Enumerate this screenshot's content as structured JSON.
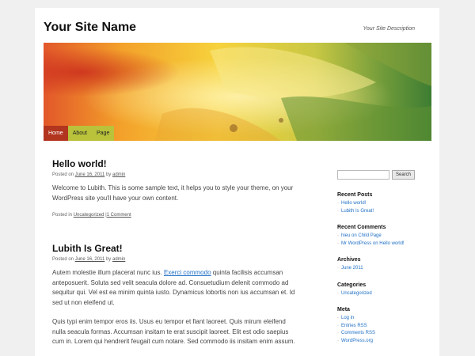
{
  "site": {
    "title": "Your Site Name",
    "description": "Your Site Description"
  },
  "nav": {
    "items": [
      {
        "label": "Home",
        "active": true
      },
      {
        "label": "About",
        "active": false
      },
      {
        "label": "Page",
        "active": false
      }
    ]
  },
  "posts": [
    {
      "title": "Hello world!",
      "meta_prefix": "Posted on",
      "date": "June 16, 2011",
      "by": "by",
      "author": "admin",
      "body": [
        "Welcome to Lubith. This is some sample text, it helps you to style your theme, on your WordPress site you'll have your own content."
      ],
      "footer_prefix": "Posted in",
      "category": "Uncategorized",
      "separator": "|",
      "comments": "1 Comment"
    },
    {
      "title": "Lubith Is Great!",
      "meta_prefix": "Posted on",
      "date": "June 16, 2011",
      "by": "by",
      "author": "admin",
      "p1_before": "Autem molestie illum placerat nunc ius. ",
      "p1_link": "Exerci commodo",
      "p1_after": " quinta facilisis accumsan anteposuerit. Soluta sed velit seacula dolore ad. Consuetudium delenit commodo ad sequitur qui. Vel est ea minim quinta iusto. Dynamicus lobortis non ius accumsan et. Id sed ut non eleifend ut.",
      "p2": "Quis typi enim tempor eros iis. Usus eu tempor et fiant laoreet. Quis mirum eleifend nulla seacula formas. Accumsan insitam te erat suscipit laoreet. Elit est odio saepius cum in. Lorem qui hendrerit feugait cum notare. Sed commodo iis insitam enim assum."
    }
  ],
  "sidebar": {
    "search_button": "Search",
    "search_value": "",
    "widgets": {
      "recent_posts": {
        "title": "Recent Posts",
        "items": [
          "Hello world!",
          "Lubith Is Great!"
        ]
      },
      "recent_comments": {
        "title": "Recent Comments",
        "items": [
          "hieu on Child Page",
          "Mr WordPress on Hello world!"
        ]
      },
      "archives": {
        "title": "Archives",
        "items": [
          "June 2011"
        ]
      },
      "categories": {
        "title": "Categories",
        "items": [
          "Uncategorized"
        ]
      },
      "meta": {
        "title": "Meta",
        "items": [
          "Log in",
          "Entries RSS",
          "Comments RSS",
          "WordPress.org"
        ]
      }
    }
  },
  "colors": {
    "nav_active": "#b2351f",
    "nav_bg": "#b9c23a",
    "link": "#1f6fc5"
  }
}
